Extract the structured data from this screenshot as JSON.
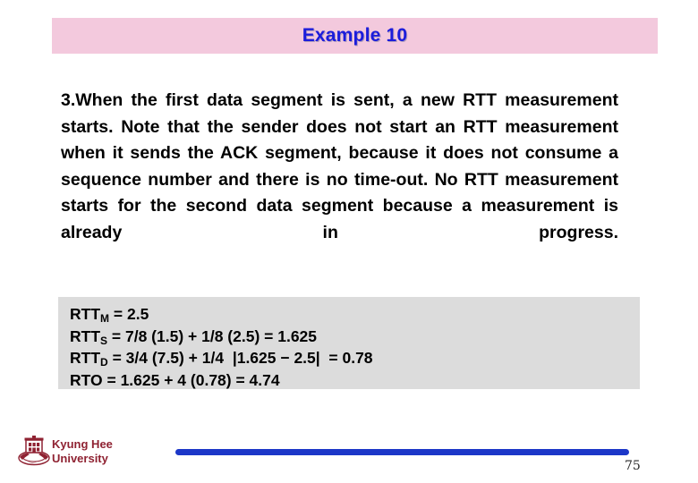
{
  "slide": {
    "title": "Example 10",
    "title_bg_color": "#f3c9dd",
    "title_text_color": "#1c1cdb"
  },
  "body": {
    "paragraph": "3.When the first data segment is sent, a new RTT measurement starts. Note that the sender does not start an RTT measurement when it sends the ACK segment, because it does not consume a sequence number and there is no time-out. No RTT measurement starts for the second data segment because a measurement is already in progress."
  },
  "formula_box": {
    "bg_color": "#dcdcdc",
    "lines": [
      {
        "label": "RTT",
        "subscript": "M",
        "expression": " = 2.5"
      },
      {
        "label": "RTT",
        "subscript": "S",
        "expression": " = 7/8 (1.5) + 1/8 (2.5) = 1.625"
      },
      {
        "label": "RTT",
        "subscript": "D",
        "expression": " = 3/4 (7.5) + 1/4  |1.625 − 2.5|  = 0.78"
      },
      {
        "label": "RTO",
        "subscript": "",
        "expression": " = 1.625 + 4 (0.78) = 4.74"
      }
    ]
  },
  "footer": {
    "university_line1": "Kyung Hee",
    "university_line2": "University",
    "university_color": "#8f2232",
    "rule_color": "#1c37c8",
    "page_number": "75"
  }
}
